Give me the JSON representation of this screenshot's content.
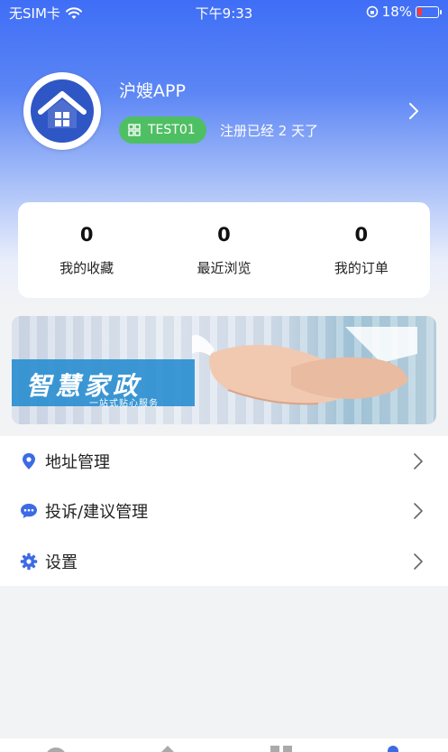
{
  "status_bar": {
    "carrier": "无SIM卡",
    "time": "下午9:33",
    "battery": "18%"
  },
  "profile": {
    "app_name": "沪嫂APP",
    "username": "TEST01",
    "registration_text": "注册已经 2 天了"
  },
  "stats": [
    {
      "value": "0",
      "label": "我的收藏"
    },
    {
      "value": "0",
      "label": "最近浏览"
    },
    {
      "value": "0",
      "label": "我的订单"
    }
  ],
  "banner": {
    "title": "智慧家政",
    "subtitle": "一站式贴心服务"
  },
  "menu": [
    {
      "label": "地址管理",
      "icon": "location-pin-icon"
    },
    {
      "label": "投诉/建议管理",
      "icon": "chat-bubble-icon"
    },
    {
      "label": "设置",
      "icon": "gear-icon"
    }
  ],
  "colors": {
    "accent": "#3f6ef6",
    "tag_green": "#4fbf63",
    "icon_blue": "#3d6be4"
  }
}
